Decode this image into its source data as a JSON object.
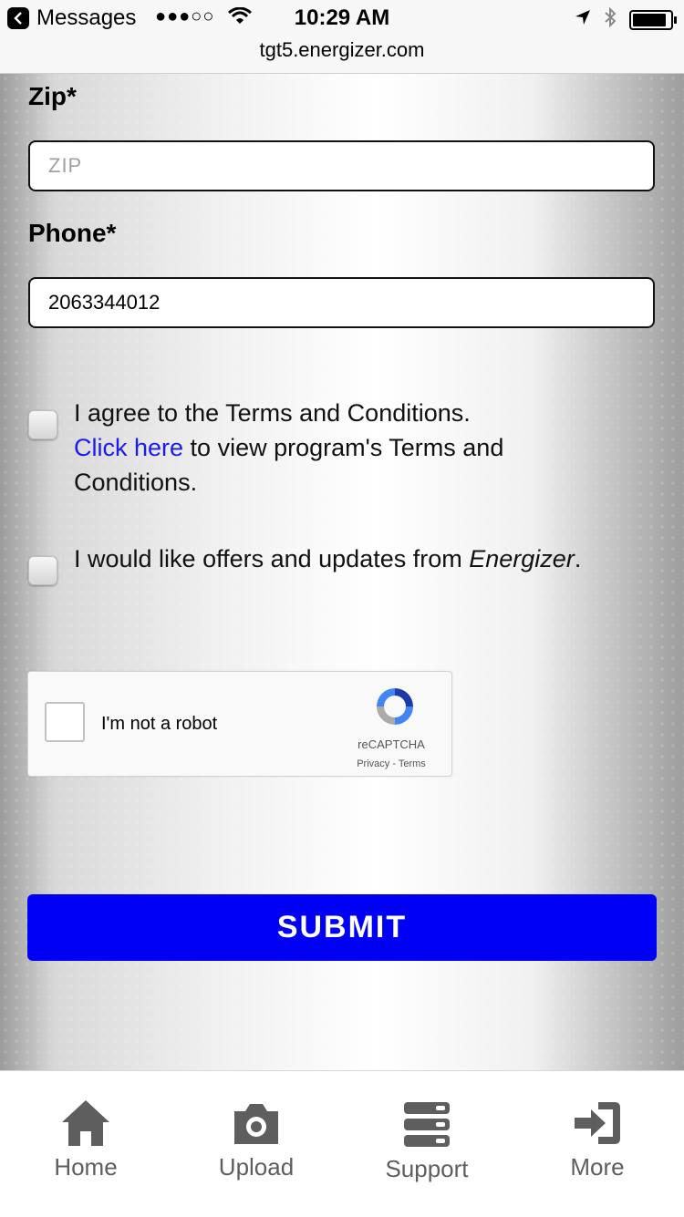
{
  "status_bar": {
    "back_app": "Messages",
    "signal": "●●●○○",
    "time": "10:29 AM",
    "url": "tgt5.energizer.com"
  },
  "form": {
    "zip_label": "Zip*",
    "zip_placeholder": "ZIP",
    "zip_value": "",
    "phone_label": "Phone*",
    "phone_value": "2063344012",
    "terms_text_1": "I agree to the Terms and Conditions.",
    "terms_link": "Click here",
    "terms_text_2": " to view program's Terms and Conditions.",
    "offers_text_1": "I would like offers and updates from ",
    "offers_brand": "Energizer",
    "offers_text_2": ".",
    "recaptcha_label": "I'm not a robot",
    "recaptcha_brand": "reCAPTCHA",
    "recaptcha_links": "Privacy - Terms",
    "submit_label": "SUBMIT"
  },
  "tabs": [
    {
      "label": "Home",
      "icon": "home-icon"
    },
    {
      "label": "Upload",
      "icon": "camera-icon"
    },
    {
      "label": "Support",
      "icon": "server-icon"
    },
    {
      "label": "More",
      "icon": "sign-in-icon"
    }
  ],
  "colors": {
    "accent": "#0000f5",
    "link": "#1b1bea",
    "tab_icon": "#5e5e5e"
  }
}
